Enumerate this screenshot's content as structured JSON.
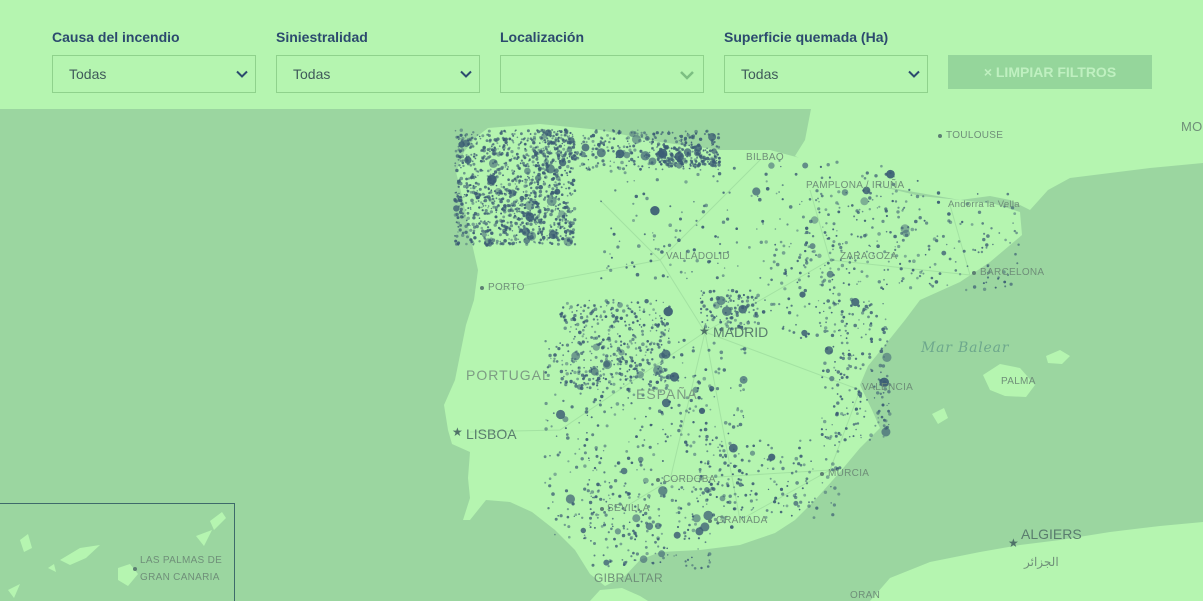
{
  "filters": [
    {
      "label": "Causa del incendio",
      "value": "Todas"
    },
    {
      "label": "Siniestralidad",
      "value": "Todas"
    },
    {
      "label": "Localización",
      "value": ""
    },
    {
      "label": "Superficie quemada (Ha)",
      "value": "Todas"
    }
  ],
  "clear_button": "× LIMPIAR FILTROS",
  "map": {
    "sea_label": "Mar Balear",
    "countries": {
      "portugal": "PORTUGAL",
      "spain": "ESPAÑA"
    },
    "capitals": {
      "madrid": "MADRID",
      "lisboa": "LISBOA",
      "algiers": "ALGIERS",
      "algiers_ar": "الجزائر"
    },
    "cities": {
      "toulouse": "TOULOUSE",
      "bilbao": "BILBAO",
      "pamplona": "PAMPLONA / IRUÑA",
      "andorra": "Andorra la Vella",
      "valladolid": "VALLADOLID",
      "zaragoza": "ZARAGOZA",
      "barcelona": "BARCELONA",
      "porto": "PORTO",
      "valencia": "VALENCIA",
      "palma": "PALMA",
      "murcia": "MURCIA",
      "cordoba": "CORDOBA",
      "sevilla": "SEVILLA",
      "granada": "GRANADA",
      "gibraltar": "GIBRALTAR",
      "oran": "ORAN",
      "mo": "MO"
    },
    "canary": {
      "line1": "LAS PALMAS DE",
      "line2": "GRAN CANARIA"
    },
    "colors": {
      "land": "#b5f5b0",
      "sea": "#9bd6a0",
      "fire_dot": "#3b5c74",
      "roads": "#a3e2a2"
    }
  }
}
